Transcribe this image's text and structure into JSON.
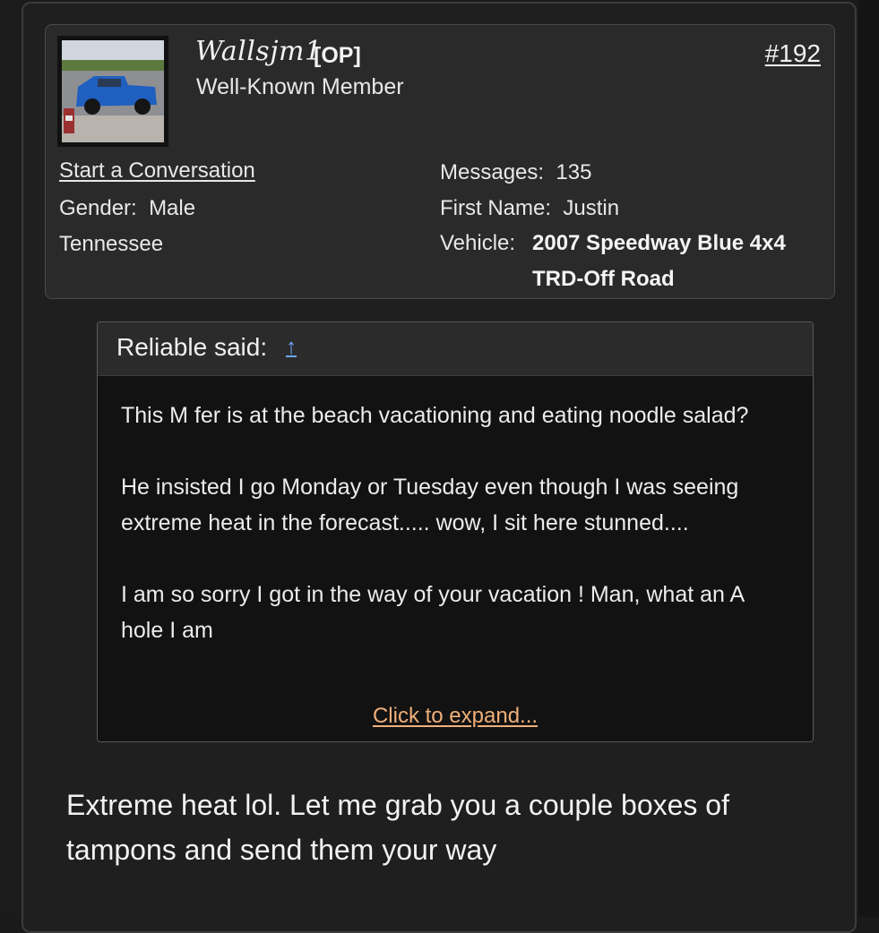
{
  "post": {
    "number": "#192"
  },
  "user": {
    "name": "Wallsjm1",
    "op_tag": "[OP]",
    "title": "Well-Known Member",
    "start_conversation": "Start a Conversation",
    "gender_label": "Gender:",
    "gender_value": "Male",
    "location": "Tennessee",
    "messages_label": "Messages:",
    "messages_value": "135",
    "first_name_label": "First Name:",
    "first_name_value": "Justin",
    "vehicle_label": "Vehicle:",
    "vehicle_value_line1": "2007 Speedway Blue 4x4",
    "vehicle_value_line2": "TRD-Off Road"
  },
  "quote": {
    "said": "Reliable said:",
    "arrow": "↑",
    "paragraphs": [
      "This M fer is at the beach vacationing and eating noodle salad?",
      "He insisted I go Monday or Tuesday even though I was seeing extreme heat in the forecast..... wow, I sit here stunned....",
      "I am so sorry I got in the way of your vacation ! Man, what an A hole I am"
    ],
    "expand": "Click to expand..."
  },
  "reply": {
    "text": "Extreme heat lol. Let me grab you a couple boxes of tampons and send them your way"
  },
  "colors": {
    "link_accent": "#f0b07a",
    "quote_arrow": "#6fa8ff"
  }
}
